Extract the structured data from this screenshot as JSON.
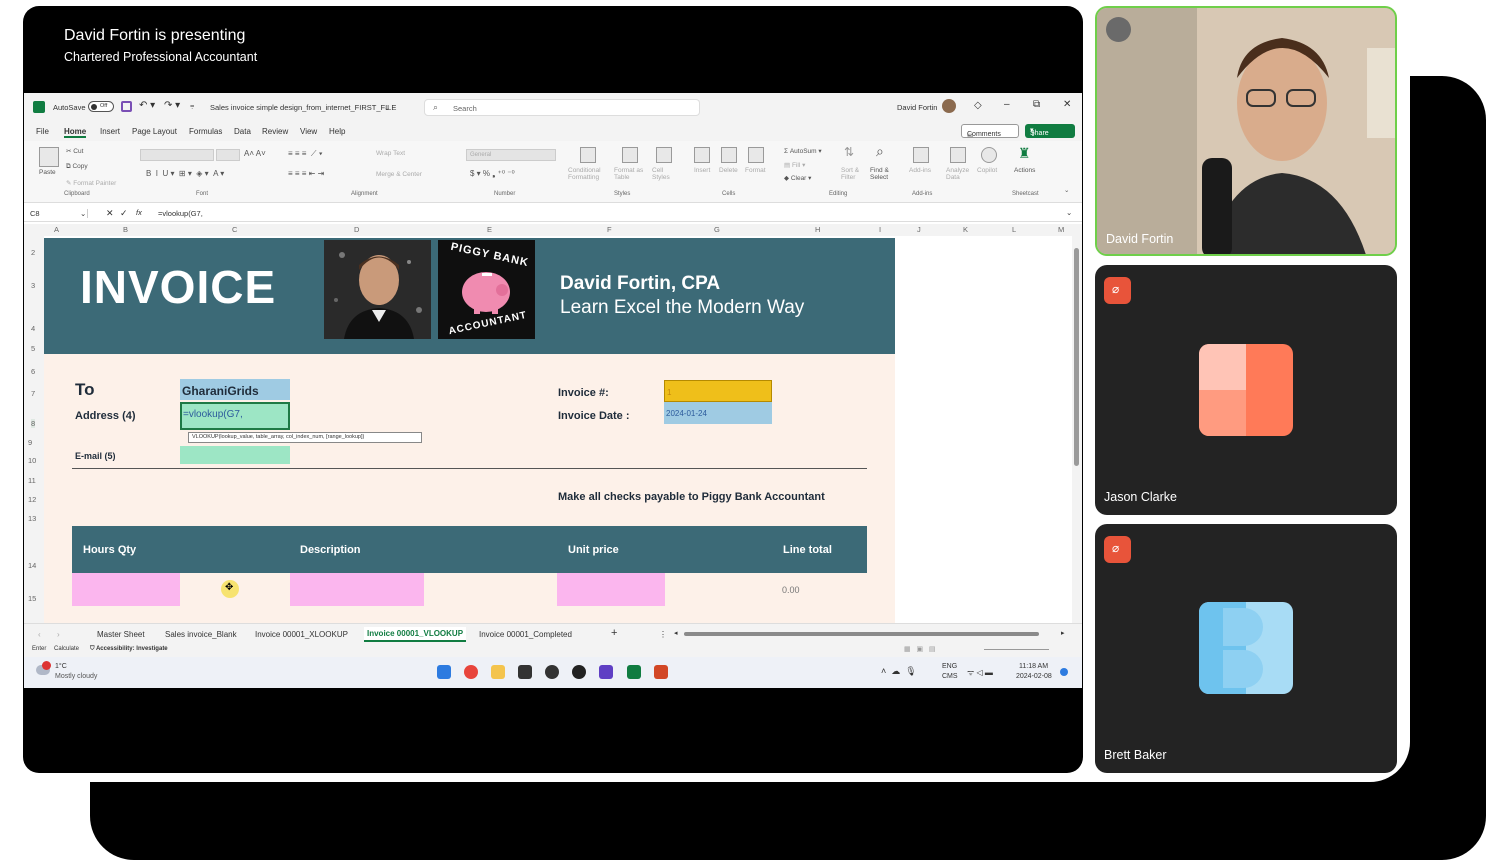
{
  "presenter": {
    "title": "David Fortin is presenting",
    "subtitle": "Chartered Professional Accountant"
  },
  "excel": {
    "autosave_label": "AutoSave",
    "autosave_state": "Off",
    "file_name": "Sales invoice simple design_from_internet_FIRST_FILE",
    "search_placeholder": "Search",
    "user": "David Fortin",
    "menu": [
      "File",
      "Home",
      "Insert",
      "Page Layout",
      "Formulas",
      "Data",
      "Review",
      "View",
      "Help"
    ],
    "comments_label": "Comments",
    "share_label": "Share",
    "ribbon": {
      "paste": "Paste",
      "cut": "Cut",
      "copy": "Copy",
      "format_painter": "Format Painter",
      "clipboard": "Clipboard",
      "font": "Font",
      "alignment": "Alignment",
      "number": "Number",
      "styles": "Styles",
      "cells": "Cells",
      "editing": "Editing",
      "addins": "Add-ins",
      "sheetcast": "Sheetcast",
      "wrap_text": "Wrap Text",
      "merge_center": "Merge & Center",
      "general": "General",
      "conditional_formatting": "Conditional Formatting",
      "format_as_table": "Format as Table",
      "cell_styles": "Cell Styles",
      "insert": "Insert",
      "delete": "Delete",
      "format": "Format",
      "autosum": "AutoSum",
      "fill": "Fill",
      "clear": "Clear",
      "sort_filter": "Sort & Filter",
      "find_select": "Find & Select",
      "addins_btn": "Add-ins",
      "analyze_data": "Analyze Data",
      "copilot": "Copilot",
      "actions": "Actions"
    },
    "name_box": "C8",
    "formula": "=vlookup(G7,",
    "columns": [
      "A",
      "B",
      "C",
      "D",
      "E",
      "F",
      "G",
      "H",
      "I",
      "J",
      "K",
      "L",
      "M"
    ],
    "rows": [
      "2",
      "3",
      "4",
      "5",
      "6",
      "7",
      "8",
      "9",
      "10",
      "11",
      "12",
      "13",
      "14",
      "15"
    ],
    "invoice": {
      "title": "INVOICE",
      "company": "David Fortin, CPA",
      "tagline": "Learn Excel the Modern Way",
      "logo_top": "PIGGY BANK",
      "logo_bottom": "ACCOUNTANT",
      "to_label": "To",
      "to_value": "GharaniGrids",
      "address_label": "Address (4)",
      "address_value": "=vlookup(G7,",
      "tooltip": "VLOOKUP(lookup_value, table_array, col_index_num, [range_lookup])",
      "email_label": "E-mail (5)",
      "invoice_no_label": "Invoice #:",
      "invoice_no_value": "1",
      "invoice_date_label": "Invoice Date :",
      "invoice_date_value": "2024-01-24",
      "checks_note": "Make all checks payable to Piggy Bank Accountant",
      "table_headers": [
        "Hours Qty",
        "Description",
        "Unit price",
        "Line total"
      ],
      "line_total": "0.00"
    },
    "sheet_tabs": [
      "Master Sheet",
      "Sales invoice_Blank",
      "Invoice 00001_XLOOKUP",
      "Invoice 00001_VLOOKUP",
      "Invoice 00001_Completed"
    ],
    "active_tab": "Invoice 00001_VLOOKUP",
    "status": {
      "mode": "Enter",
      "calc": "Calculate",
      "accessibility": "Accessibility: Investigate"
    },
    "taskbar": {
      "weather_temp": "1°C",
      "weather_desc": "Mostly cloudy",
      "lang1": "ENG",
      "lang2": "CMS",
      "time": "11:18 AM",
      "date": "2024-02-08"
    }
  },
  "participants": [
    {
      "name": "David Fortin"
    },
    {
      "name": "Jason Clarke"
    },
    {
      "name": "Brett Baker"
    }
  ],
  "colors": {
    "banner": "#3c6a77",
    "peach": "#fdf1e9",
    "excel_green": "#107c41",
    "mute_red": "#e8543a"
  }
}
